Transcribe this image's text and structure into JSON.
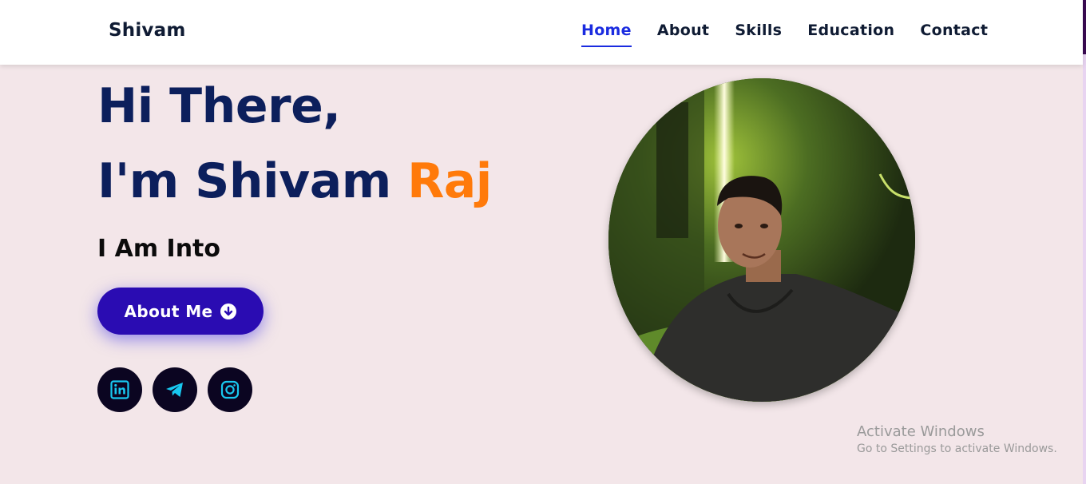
{
  "header": {
    "brand": "Shivam",
    "nav": [
      "Home",
      "About",
      "Skills",
      "Education",
      "Contact"
    ],
    "active_index": 0
  },
  "hero": {
    "line1": "Hi There,",
    "line2_main": "I'm Shivam ",
    "line2_accent": "Raj",
    "subtitle": "I Am Into",
    "button_label": "About Me"
  },
  "socials": [
    {
      "icon": "linkedin-icon"
    },
    {
      "icon": "telegram-icon"
    },
    {
      "icon": "instagram-icon"
    }
  ],
  "watermark": {
    "title": "Activate Windows",
    "subtitle": "Go to Settings to activate Windows."
  },
  "colors": {
    "background": "#f3e6e9",
    "heading": "#0c1f5c",
    "accent": "#ff7a0a",
    "nav_active": "#1a2be0",
    "button": "#2a0cb2",
    "social_bg": "#0b0521",
    "social_icon": "#18c8f0"
  }
}
